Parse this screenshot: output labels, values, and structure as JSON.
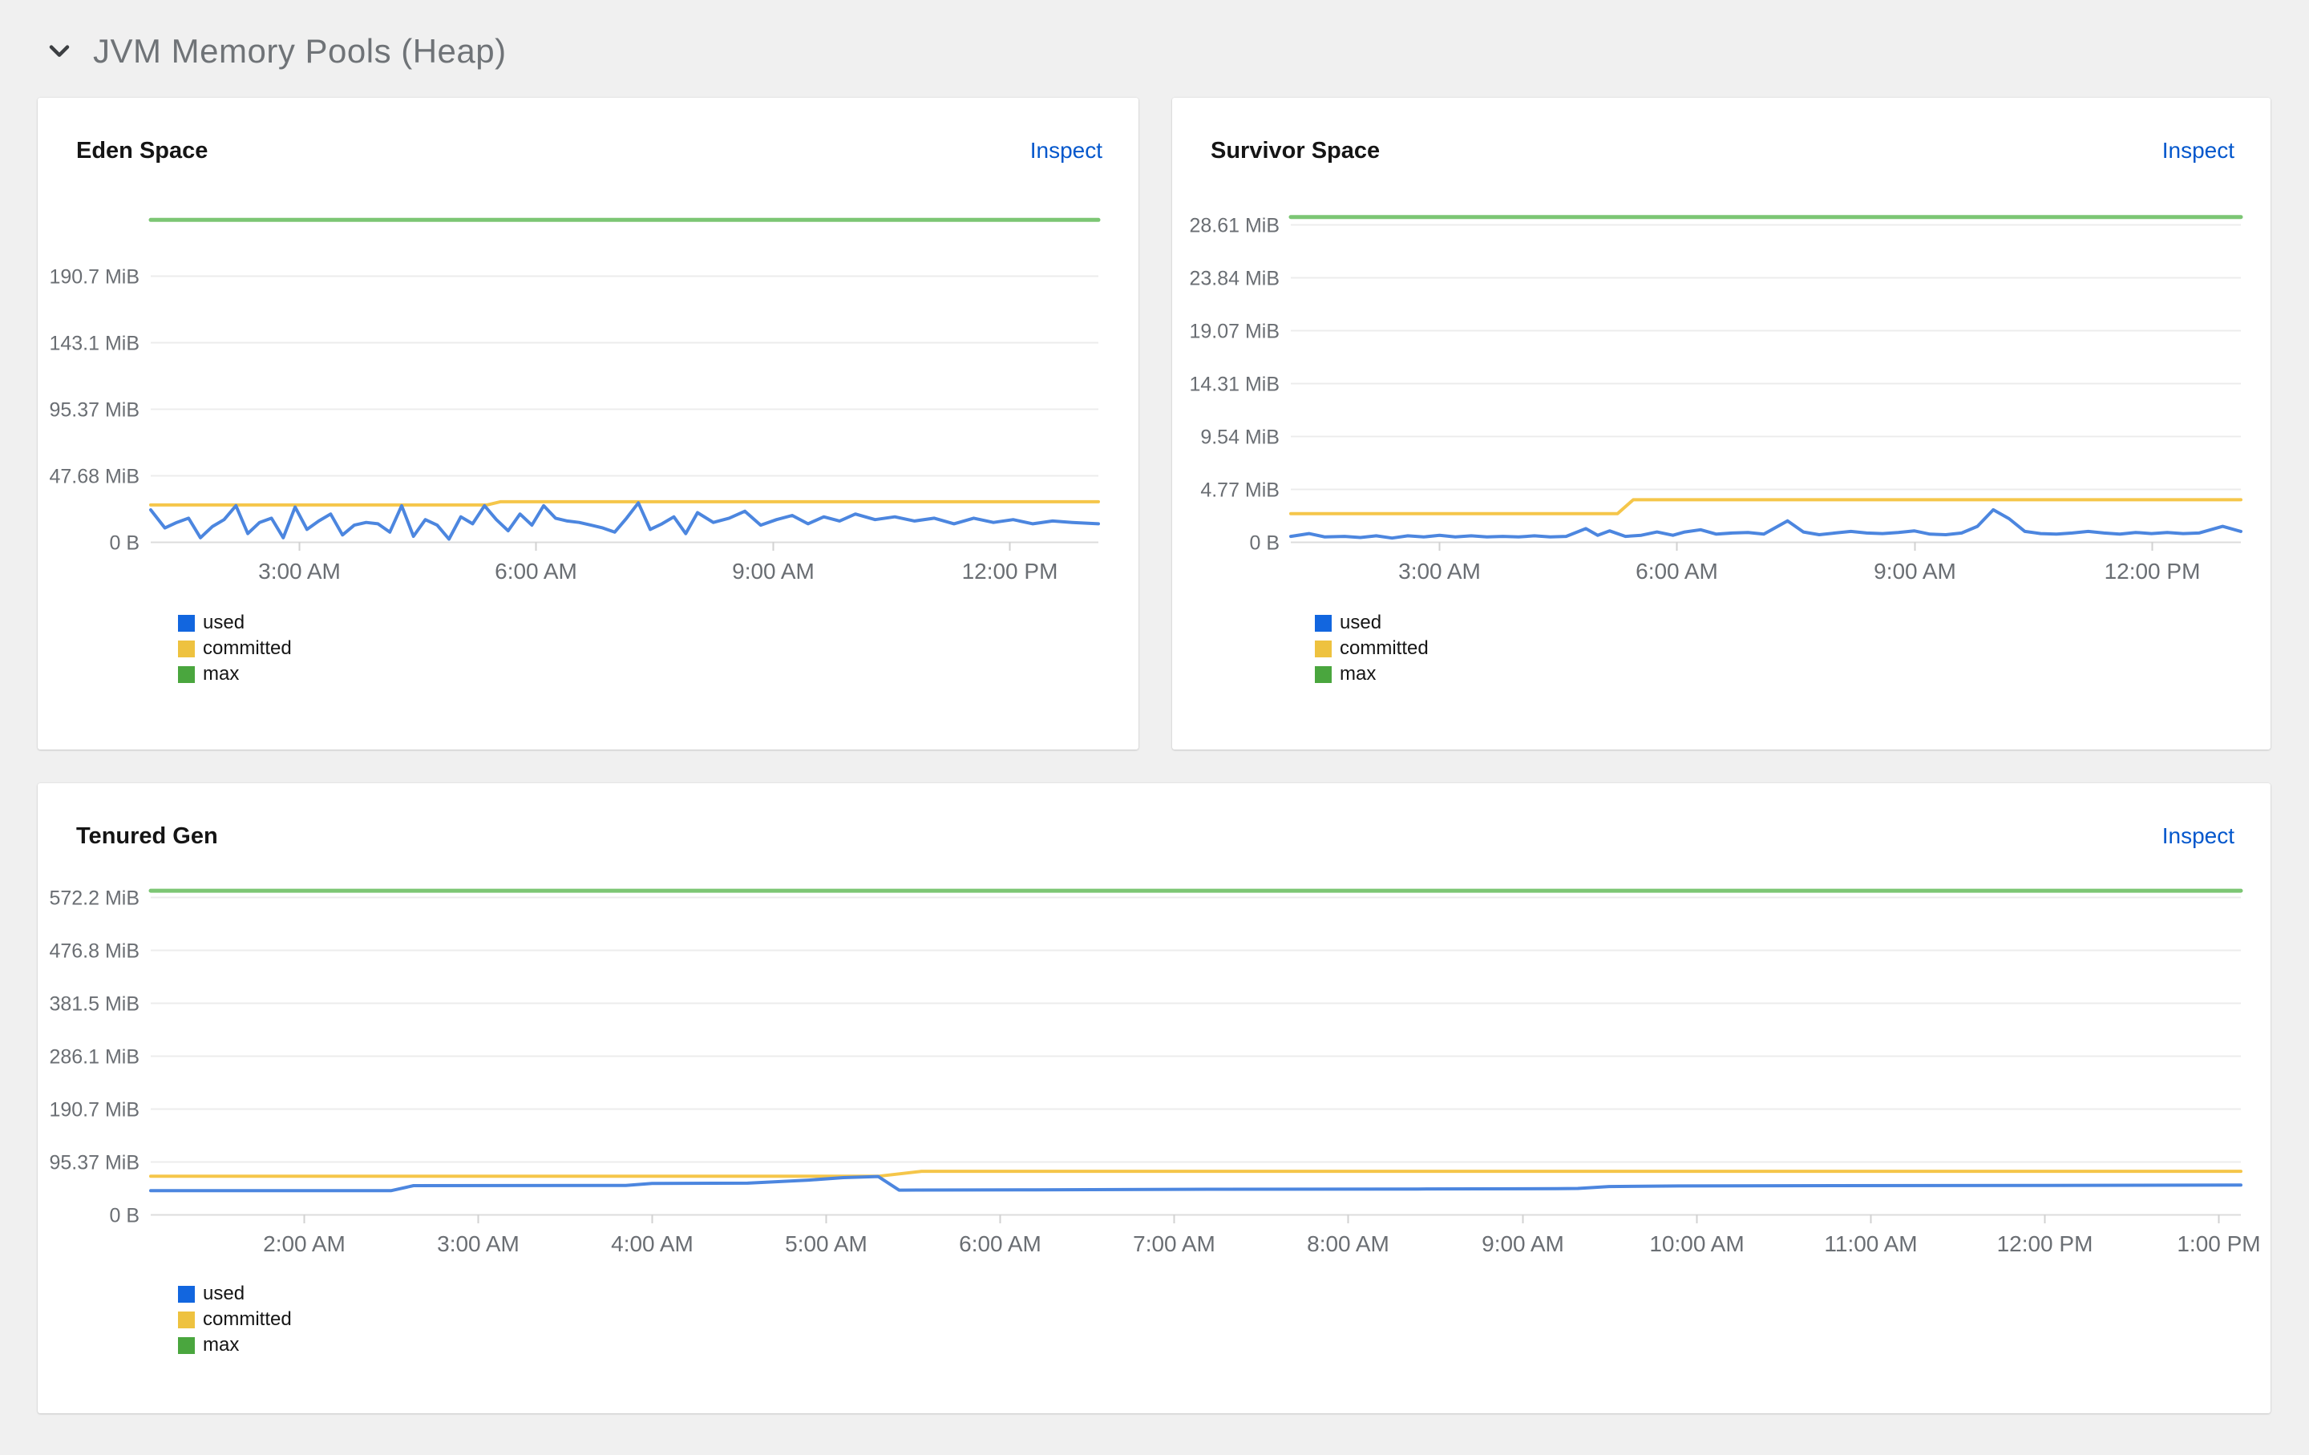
{
  "header": {
    "title": "JVM Memory Pools (Heap)"
  },
  "colors": {
    "page_background": "#f0f0f0",
    "card_background": "#ffffff",
    "link": "#0357cc",
    "axis_text": "#6a6e73",
    "gridline": "#ececec",
    "baseline": "#dcdcdc",
    "used_line": "#4c86df",
    "committed_line": "#f5c64a",
    "max_line": "#7cc674",
    "used_swatch": "#1266df",
    "committed_swatch": "#eec23f",
    "max_swatch": "#4aa63e"
  },
  "legend": [
    {
      "label": "used",
      "color": "#1266df"
    },
    {
      "label": "committed",
      "color": "#eec23f"
    },
    {
      "label": "max",
      "color": "#4aa63e"
    }
  ],
  "panels": [
    {
      "title": "Eden Space",
      "action": "Inspect"
    },
    {
      "title": "Survivor Space",
      "action": "Inspect"
    },
    {
      "title": "Tenured Gen",
      "action": "Inspect"
    }
  ],
  "chart_data": [
    {
      "type": "line",
      "title": "Eden Space",
      "y_unit": "MiB",
      "xlabel": "",
      "ylabel": "",
      "grid": true,
      "legend_position": "bottom-left",
      "xlim": [
        1.12,
        13.13
      ],
      "ylim": [
        0,
        245
      ],
      "yticks": [
        {
          "v": 190.7,
          "label": "190.7 MiB"
        },
        {
          "v": 143.1,
          "label": "143.1 MiB"
        },
        {
          "v": 95.37,
          "label": "95.37 MiB"
        },
        {
          "v": 47.68,
          "label": "47.68 MiB"
        },
        {
          "v": 0,
          "label": "0 B"
        }
      ],
      "xticks": [
        {
          "t": 3,
          "label": "3:00 AM"
        },
        {
          "t": 6,
          "label": "6:00 AM"
        },
        {
          "t": 9,
          "label": "9:00 AM"
        },
        {
          "t": 12,
          "label": "12:00 PM"
        }
      ],
      "series": [
        {
          "name": "max",
          "color": "#7cc674",
          "width": 5,
          "points": [
            [
              1.12,
              231
            ],
            [
              13.13,
              231
            ]
          ]
        },
        {
          "name": "committed",
          "color": "#f5c64a",
          "width": 4,
          "points": [
            [
              1.12,
              26.5
            ],
            [
              5.38,
              26.5
            ],
            [
              5.55,
              28.8
            ],
            [
              13.13,
              28.8
            ]
          ]
        },
        {
          "name": "used",
          "color": "#4c86df",
          "width": 4,
          "points": [
            [
              1.12,
              23
            ],
            [
              1.3,
              10
            ],
            [
              1.45,
              14
            ],
            [
              1.6,
              17
            ],
            [
              1.75,
              3
            ],
            [
              1.9,
              11
            ],
            [
              2.05,
              16
            ],
            [
              2.2,
              26
            ],
            [
              2.35,
              6
            ],
            [
              2.5,
              14
            ],
            [
              2.65,
              17
            ],
            [
              2.8,
              3
            ],
            [
              2.95,
              25
            ],
            [
              3.1,
              9
            ],
            [
              3.25,
              15
            ],
            [
              3.4,
              20
            ],
            [
              3.55,
              5
            ],
            [
              3.7,
              12
            ],
            [
              3.85,
              14
            ],
            [
              4.0,
              13
            ],
            [
              4.15,
              7
            ],
            [
              4.3,
              26
            ],
            [
              4.45,
              4
            ],
            [
              4.6,
              16
            ],
            [
              4.75,
              12
            ],
            [
              4.9,
              2
            ],
            [
              5.05,
              18
            ],
            [
              5.2,
              13
            ],
            [
              5.35,
              26
            ],
            [
              5.5,
              16
            ],
            [
              5.65,
              8
            ],
            [
              5.8,
              20
            ],
            [
              5.95,
              12
            ],
            [
              6.1,
              26
            ],
            [
              6.25,
              17
            ],
            [
              6.4,
              15
            ],
            [
              6.55,
              14
            ],
            [
              6.7,
              12
            ],
            [
              6.85,
              10
            ],
            [
              7.0,
              7
            ],
            [
              7.15,
              17
            ],
            [
              7.3,
              28
            ],
            [
              7.45,
              9
            ],
            [
              7.6,
              13
            ],
            [
              7.75,
              18
            ],
            [
              7.9,
              6
            ],
            [
              8.05,
              21
            ],
            [
              8.25,
              14
            ],
            [
              8.45,
              17
            ],
            [
              8.65,
              22
            ],
            [
              8.85,
              12
            ],
            [
              9.05,
              16
            ],
            [
              9.25,
              19
            ],
            [
              9.45,
              13
            ],
            [
              9.65,
              18
            ],
            [
              9.85,
              15
            ],
            [
              10.05,
              20
            ],
            [
              10.3,
              16
            ],
            [
              10.55,
              18
            ],
            [
              10.8,
              15
            ],
            [
              11.05,
              17
            ],
            [
              11.3,
              13
            ],
            [
              11.55,
              17
            ],
            [
              11.8,
              14
            ],
            [
              12.05,
              16
            ],
            [
              12.3,
              13
            ],
            [
              12.55,
              15
            ],
            [
              12.8,
              14
            ],
            [
              13.13,
              13
            ]
          ]
        }
      ]
    },
    {
      "type": "line",
      "title": "Survivor Space",
      "y_unit": "MiB",
      "xlabel": "",
      "ylabel": "",
      "grid": true,
      "legend_position": "bottom-left",
      "xlim": [
        1.12,
        13.13
      ],
      "ylim": [
        0,
        30.8
      ],
      "yticks": [
        {
          "v": 28.61,
          "label": "28.61 MiB"
        },
        {
          "v": 23.84,
          "label": "23.84 MiB"
        },
        {
          "v": 19.07,
          "label": "19.07 MiB"
        },
        {
          "v": 14.31,
          "label": "14.31 MiB"
        },
        {
          "v": 9.54,
          "label": "9.54 MiB"
        },
        {
          "v": 4.77,
          "label": "4.77 MiB"
        },
        {
          "v": 0,
          "label": "0 B"
        }
      ],
      "xticks": [
        {
          "t": 3,
          "label": "3:00 AM"
        },
        {
          "t": 6,
          "label": "6:00 AM"
        },
        {
          "t": 9,
          "label": "9:00 AM"
        },
        {
          "t": 12,
          "label": "12:00 PM"
        }
      ],
      "series": [
        {
          "name": "max",
          "color": "#7cc674",
          "width": 5,
          "points": [
            [
              1.12,
              29.3
            ],
            [
              13.13,
              29.3
            ]
          ]
        },
        {
          "name": "committed",
          "color": "#f5c64a",
          "width": 4,
          "points": [
            [
              1.12,
              2.55
            ],
            [
              5.25,
              2.55
            ],
            [
              5.45,
              3.8
            ],
            [
              13.13,
              3.8
            ]
          ]
        },
        {
          "name": "used",
          "color": "#4c86df",
          "width": 4,
          "points": [
            [
              1.12,
              0.5
            ],
            [
              1.35,
              0.75
            ],
            [
              1.55,
              0.45
            ],
            [
              1.8,
              0.5
            ],
            [
              2.0,
              0.4
            ],
            [
              2.2,
              0.55
            ],
            [
              2.4,
              0.35
            ],
            [
              2.6,
              0.55
            ],
            [
              2.8,
              0.45
            ],
            [
              3.0,
              0.6
            ],
            [
              3.2,
              0.45
            ],
            [
              3.4,
              0.55
            ],
            [
              3.6,
              0.45
            ],
            [
              3.8,
              0.5
            ],
            [
              4.0,
              0.45
            ],
            [
              4.2,
              0.55
            ],
            [
              4.4,
              0.45
            ],
            [
              4.6,
              0.5
            ],
            [
              4.85,
              1.2
            ],
            [
              5.0,
              0.6
            ],
            [
              5.15,
              1.0
            ],
            [
              5.35,
              0.5
            ],
            [
              5.55,
              0.6
            ],
            [
              5.75,
              0.9
            ],
            [
              5.95,
              0.6
            ],
            [
              6.1,
              0.9
            ],
            [
              6.3,
              1.1
            ],
            [
              6.5,
              0.7
            ],
            [
              6.7,
              0.8
            ],
            [
              6.9,
              0.85
            ],
            [
              7.1,
              0.7
            ],
            [
              7.4,
              1.9
            ],
            [
              7.6,
              0.9
            ],
            [
              7.8,
              0.65
            ],
            [
              8.0,
              0.8
            ],
            [
              8.2,
              0.95
            ],
            [
              8.4,
              0.8
            ],
            [
              8.6,
              0.75
            ],
            [
              8.8,
              0.85
            ],
            [
              9.0,
              1.0
            ],
            [
              9.2,
              0.7
            ],
            [
              9.4,
              0.65
            ],
            [
              9.6,
              0.8
            ],
            [
              9.8,
              1.4
            ],
            [
              10.0,
              2.9
            ],
            [
              10.2,
              2.1
            ],
            [
              10.4,
              0.95
            ],
            [
              10.6,
              0.75
            ],
            [
              10.8,
              0.7
            ],
            [
              11.0,
              0.8
            ],
            [
              11.2,
              0.95
            ],
            [
              11.4,
              0.8
            ],
            [
              11.6,
              0.7
            ],
            [
              11.8,
              0.85
            ],
            [
              12.0,
              0.75
            ],
            [
              12.2,
              0.85
            ],
            [
              12.4,
              0.75
            ],
            [
              12.6,
              0.8
            ],
            [
              12.9,
              1.4
            ],
            [
              13.13,
              0.95
            ]
          ]
        }
      ]
    },
    {
      "type": "line",
      "title": "Tenured Gen",
      "y_unit": "MiB",
      "xlabel": "",
      "ylabel": "",
      "grid": true,
      "legend_position": "bottom-left",
      "xlim": [
        1.12,
        13.13
      ],
      "ylim": [
        0,
        600
      ],
      "yticks": [
        {
          "v": 572.2,
          "label": "572.2 MiB"
        },
        {
          "v": 476.8,
          "label": "476.8 MiB"
        },
        {
          "v": 381.5,
          "label": "381.5 MiB"
        },
        {
          "v": 286.1,
          "label": "286.1 MiB"
        },
        {
          "v": 190.7,
          "label": "190.7 MiB"
        },
        {
          "v": 95.37,
          "label": "95.37 MiB"
        },
        {
          "v": 0,
          "label": "0 B"
        }
      ],
      "xticks": [
        {
          "t": 2,
          "label": "2:00 AM"
        },
        {
          "t": 3,
          "label": "3:00 AM"
        },
        {
          "t": 4,
          "label": "4:00 AM"
        },
        {
          "t": 5,
          "label": "5:00 AM"
        },
        {
          "t": 6,
          "label": "6:00 AM"
        },
        {
          "t": 7,
          "label": "7:00 AM"
        },
        {
          "t": 8,
          "label": "8:00 AM"
        },
        {
          "t": 9,
          "label": "9:00 AM"
        },
        {
          "t": 10,
          "label": "10:00 AM"
        },
        {
          "t": 11,
          "label": "11:00 AM"
        },
        {
          "t": 12,
          "label": "12:00 PM"
        },
        {
          "t": 13,
          "label": "1:00 PM"
        }
      ],
      "series": [
        {
          "name": "max",
          "color": "#7cc674",
          "width": 5,
          "points": [
            [
              1.12,
              584
            ],
            [
              13.13,
              584
            ]
          ]
        },
        {
          "name": "committed",
          "color": "#f5c64a",
          "width": 4,
          "points": [
            [
              1.12,
              69
            ],
            [
              5.3,
              69
            ],
            [
              5.55,
              78
            ],
            [
              13.13,
              78
            ]
          ]
        },
        {
          "name": "used",
          "color": "#4c86df",
          "width": 4,
          "points": [
            [
              1.12,
              43
            ],
            [
              2.5,
              43
            ],
            [
              2.63,
              52
            ],
            [
              3.85,
              52.5
            ],
            [
              4.0,
              56
            ],
            [
              4.55,
              56.5
            ],
            [
              4.9,
              62
            ],
            [
              5.1,
              66.5
            ],
            [
              5.3,
              68.5
            ],
            [
              5.42,
              44
            ],
            [
              6.2,
              44.5
            ],
            [
              7.2,
              45.5
            ],
            [
              8.4,
              46
            ],
            [
              9.2,
              46.5
            ],
            [
              9.32,
              47
            ],
            [
              9.5,
              50.5
            ],
            [
              9.9,
              51.5
            ],
            [
              10.8,
              52
            ],
            [
              12.0,
              52.5
            ],
            [
              13.13,
              53
            ]
          ]
        }
      ]
    }
  ]
}
